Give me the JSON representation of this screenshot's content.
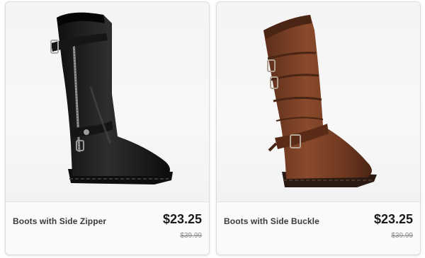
{
  "products": [
    {
      "name": "Boots with Side Zipper",
      "price": "$23.25",
      "original_price": "$39.99",
      "image": "black-boot-image",
      "boot_color": "#1f1f1f"
    },
    {
      "name": "Boots with Side Buckle",
      "price": "$23.25",
      "original_price": "$39.99",
      "image": "brown-boot-image",
      "boot_color": "#7a4028"
    }
  ]
}
